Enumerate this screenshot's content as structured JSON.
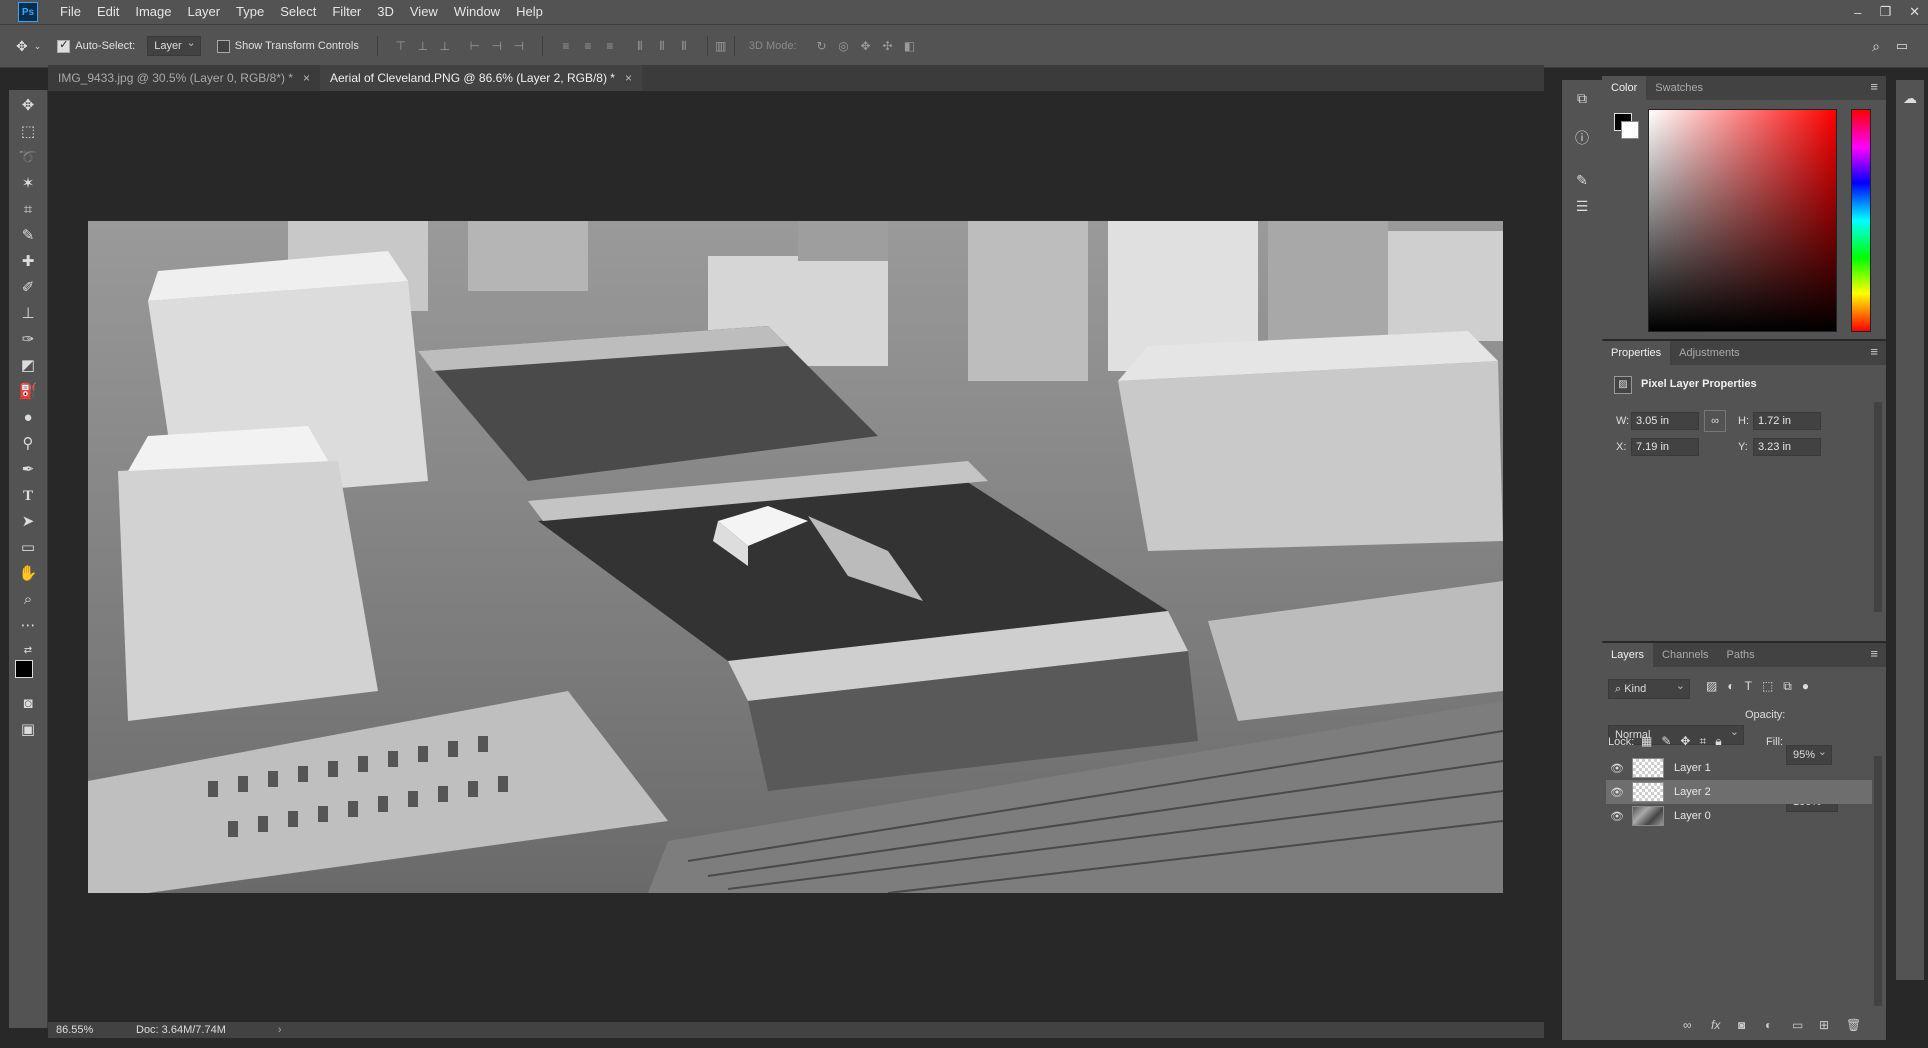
{
  "menu": [
    "File",
    "Edit",
    "Image",
    "Layer",
    "Type",
    "Select",
    "Filter",
    "3D",
    "View",
    "Window",
    "Help"
  ],
  "app_logo": "Ps",
  "options": {
    "auto_select_label": "Auto-Select:",
    "auto_select_value": "Layer",
    "show_transform_label": "Show Transform Controls",
    "mode_3d_label": "3D Mode:"
  },
  "tabs": [
    {
      "label": "IMG_9433.jpg @ 30.5% (Layer 0, RGB/8*) *",
      "active": false
    },
    {
      "label": "Aerial of Cleveland.PNG @ 86.6% (Layer 2, RGB/8) *",
      "active": true
    }
  ],
  "status": {
    "zoom": "86.55%",
    "doc": "Doc: 3.64M/7.74M"
  },
  "color_panel": {
    "tabs": [
      "Color",
      "Swatches"
    ]
  },
  "properties_panel": {
    "tabs": [
      "Properties",
      "Adjustments"
    ],
    "title": "Pixel Layer Properties",
    "w_label": "W:",
    "w": "3.05 in",
    "h_label": "H:",
    "h": "1.72 in",
    "x_label": "X:",
    "x": "7.19 in",
    "y_label": "Y:",
    "y": "3.23 in"
  },
  "layers_panel": {
    "tabs": [
      "Layers",
      "Channels",
      "Paths"
    ],
    "kind": "Kind",
    "blend_mode": "Normal",
    "opacity_label": "Opacity:",
    "opacity": "95%",
    "lock_label": "Lock:",
    "fill_label": "Fill:",
    "fill": "100%",
    "layers": [
      {
        "name": "Layer 1",
        "selected": false
      },
      {
        "name": "Layer 2",
        "selected": true
      },
      {
        "name": "Layer 0",
        "selected": false
      }
    ]
  },
  "colors": {
    "ui_bg": "#535353",
    "canvas_bg": "#282828",
    "selected_layer": "#6e6e6e"
  }
}
